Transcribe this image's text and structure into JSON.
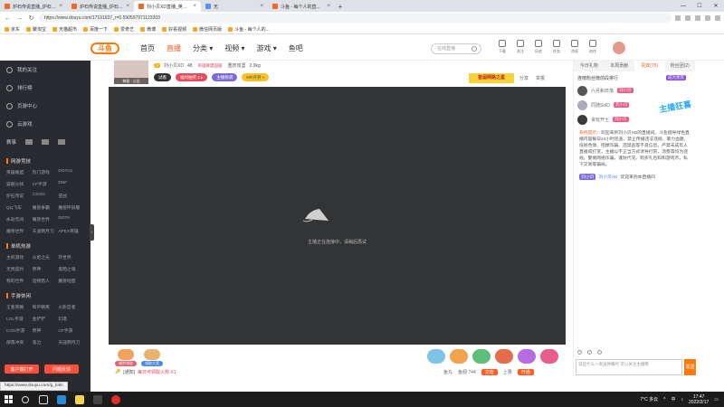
{
  "browser": {
    "tabs": [
      {
        "title": "炉石传说直播_炉石传说直播视...",
        "active": false
      },
      {
        "title": "炉石传说直播_炉石传说直播视...",
        "active": false
      },
      {
        "title": "刘小贝XD直播_英雄联盟直播_斗...",
        "active": true
      },
      {
        "title": "无",
        "active": false
      },
      {
        "title": "斗鱼 - 每个人的直...",
        "active": false
      }
    ],
    "url": "https://www.douyu.com/17191637_r=0.590597971123203",
    "bookmarks": [
      "京东",
      "聚淘宝",
      "天猫超市",
      "百度一下",
      "爱奇艺",
      "微博",
      "好看视频",
      "微信网页版",
      "斗鱼 - 每个人的..."
    ]
  },
  "site": {
    "logo": "斗鱼",
    "nav": [
      {
        "label": "首页",
        "active": false
      },
      {
        "label": "直播",
        "active": true
      },
      {
        "label": "分类 ▾",
        "active": false
      },
      {
        "label": "视频 ▾",
        "active": false
      },
      {
        "label": "游戏 ▾",
        "active": false
      },
      {
        "label": "鱼吧",
        "active": false
      }
    ],
    "search_placeholder": "在线直播",
    "header_icons": [
      "下载",
      "关注",
      "历史",
      "任务",
      "消息",
      "创作"
    ]
  },
  "sidebar": {
    "top_items": [
      "我的关注",
      "排行榜",
      "页游中心",
      "云游戏"
    ],
    "icon_row": [
      "赛事"
    ],
    "sections": [
      {
        "title": "网游竞技",
        "items": [
          "英雄联盟",
          "热门游戏",
          "DOTA2",
          "穿越火线",
          "CF手游",
          "DNF",
          "炉石传说",
          "CSGO",
          "逆战",
          "QQ飞车",
          "魔兽争霸",
          "魔兽怀旧服",
          "永劫无间",
          "魔兽世界",
          "DOTA",
          "魔兽世界",
          "天涯明月刀",
          "APEX英雄"
        ]
      },
      {
        "title": "单机热游",
        "items": [
          "主机游戏",
          "火炬之光",
          "环世界",
          "无畏契约",
          "原神",
          "黑暗之魂",
          "我的世界",
          "怪物猎人",
          "魔兽地图"
        ]
      },
      {
        "title": "手游休闲",
        "items": [
          "王者荣耀",
          "和平精英",
          "火影忍者",
          "LOL手游",
          "金铲铲",
          "幻塔",
          "COD手游",
          "原神",
          "CF手游",
          "部落冲突",
          "鬼泣",
          "天涯明月刀"
        ]
      }
    ],
    "buttons": [
      "客户端打开",
      "问题反馈"
    ]
  },
  "room": {
    "thumb_label": "神秘 · 公告",
    "streamer": "刘小贝XD",
    "hot_count": "48",
    "level_badge": "V",
    "tag_text": "英雄联盟国服",
    "category": "重庆攻坚",
    "value": "2.9kg",
    "pills": [
      "试看",
      "福利抽奖 2 ▸",
      "主播称谓",
      "MR评测 >"
    ],
    "promo": "首届网路之星",
    "actions": [
      "分享",
      "举报"
    ]
  },
  "player": {
    "message": "主播正在连接中，请稍后再试"
  },
  "gifts": {
    "left": [
      "福利领取",
      "领取大奖"
    ],
    "tip_label": "[通知]",
    "tip_text": "每日可领取火箭 X1",
    "bottom_stats": [
      "鱼丸",
      "鱼翅 744",
      "充值",
      "上限"
    ],
    "bottom_button": "开通"
  },
  "right_panel": {
    "tabs": [
      {
        "label": "今日礼物",
        "active": false
      },
      {
        "label": "本周贡献",
        "active": false
      },
      {
        "label": "贵宾(75)",
        "active": true
      },
      {
        "label": "粉丝团(2)",
        "active": false
      }
    ],
    "ranking_title": "连榜粉丝榜前段排行",
    "rank_badge": "成为贵宾",
    "ranks": [
      {
        "name": "六月和日落",
        "level": "刘小贝"
      },
      {
        "name": "同骑SolD",
        "level": "刘小贝"
      },
      {
        "name": "贪玩开士",
        "level": "刘小贝"
      }
    ],
    "big_sticker": "主播狂喜",
    "system_prefix": "系统提示：",
    "system_msg": "欢迎来到刘小贝XD的直播间。斗鱼倡导绿色直播内容每日24小时巡查，禁止传播违法违规、暴力血腥、低俗色情、招嫖诈骗、违禁品等不良信息。严禁未成年人直播或打赏。主播以不正当方式诱导打赏、消费等均为违规。警惕网络诈骗，谨防代充、购买礼包码和游戏币，私下交易等骗局。",
    "chat": {
      "badge": "刘小贝",
      "name": "刘小贝XD",
      "text": "欢迎来到本直播间"
    },
    "input_placeholder": "说些什么～发送弹幕时 可以关注主播哦",
    "send_label": "发送"
  },
  "status_url": "https://www.douyu.com/g_lolm",
  "taskbar": {
    "weather": "7°C 多云",
    "time": "17:47",
    "date": "2022/2/17",
    "ime": "中"
  }
}
